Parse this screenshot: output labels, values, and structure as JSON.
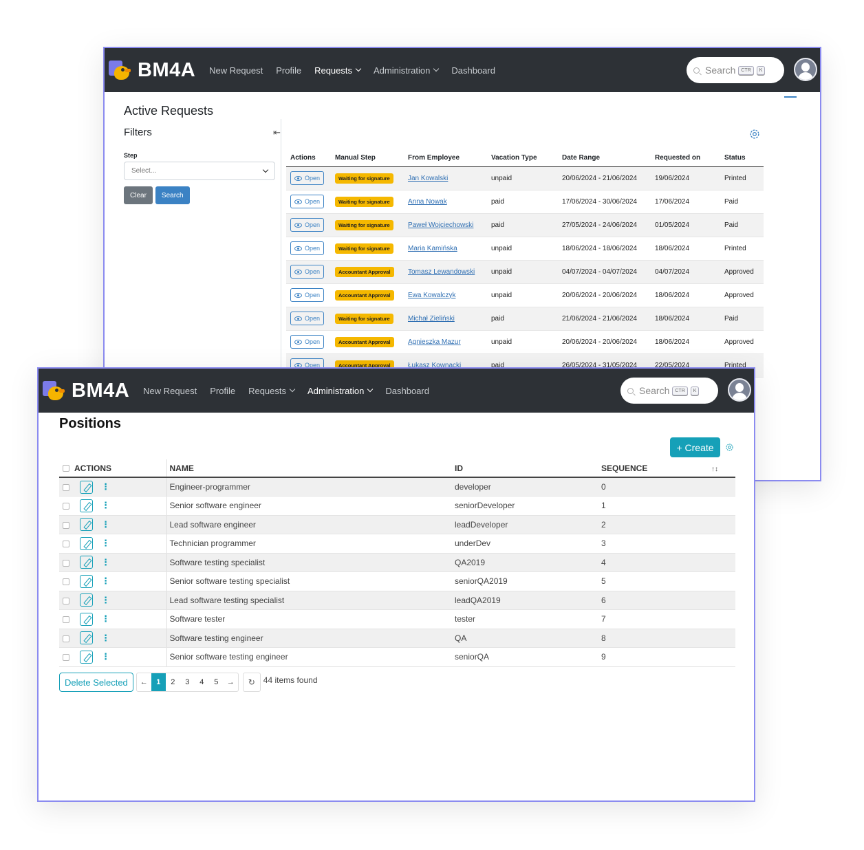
{
  "back_window": {
    "navbar": {
      "brand": "BM4A",
      "nav": [
        {
          "label": "New Request"
        },
        {
          "label": "Profile"
        },
        {
          "label": "Requests"
        },
        {
          "label": "Administration"
        },
        {
          "label": "Dashboard"
        }
      ],
      "search_placeholder": "Search",
      "shortcut_keys": [
        "CTR",
        "K"
      ]
    },
    "title": "Active Requests",
    "filters": {
      "title": "Filters",
      "step_label": "Step",
      "select_placeholder": "Select...",
      "clear_label": "Clear",
      "search_label": "Search"
    },
    "table": {
      "columns": [
        "Actions",
        "Manual Step",
        "From Employee",
        "Vacation Type",
        "Date Range",
        "Requested on",
        "Status"
      ],
      "open_label": "Open",
      "rows": [
        {
          "step": "Waiting for signature",
          "employee": "Jan Kowalski",
          "type": "unpaid",
          "range": "20/06/2024 - 21/06/2024",
          "requested": "19/06/2024",
          "status": "Printed"
        },
        {
          "step": "Waiting for signature",
          "employee": "Anna Nowak",
          "type": "paid",
          "range": "17/06/2024 - 30/06/2024",
          "requested": "17/06/2024",
          "status": "Paid"
        },
        {
          "step": "Waiting for signature",
          "employee": "Paweł Wojciechowski",
          "type": "paid",
          "range": "27/05/2024 - 24/06/2024",
          "requested": "01/05/2024",
          "status": "Paid"
        },
        {
          "step": "Waiting for signature",
          "employee": "Maria Kamińska",
          "type": "unpaid",
          "range": "18/06/2024 - 18/06/2024",
          "requested": "18/06/2024",
          "status": "Printed"
        },
        {
          "step": "Accountant Approval",
          "employee": "Tomasz Lewandowski",
          "type": "unpaid",
          "range": "04/07/2024 - 04/07/2024",
          "requested": "04/07/2024",
          "status": "Approved"
        },
        {
          "step": "Accountant Approval",
          "employee": "Ewa Kowalczyk",
          "type": "unpaid",
          "range": "20/06/2024 - 20/06/2024",
          "requested": "18/06/2024",
          "status": "Approved"
        },
        {
          "step": "Waiting for signature",
          "employee": "Michał Zieliński",
          "type": "paid",
          "range": "21/06/2024 - 21/06/2024",
          "requested": "18/06/2024",
          "status": "Paid"
        },
        {
          "step": "Accountant Approval",
          "employee": "Agnieszka Mazur",
          "type": "unpaid",
          "range": "20/06/2024 - 20/06/2024",
          "requested": "18/06/2024",
          "status": "Approved"
        },
        {
          "step": "Accountant Approval",
          "employee": "Łukasz Kownacki",
          "type": "paid",
          "range": "26/05/2024 - 31/05/2024",
          "requested": "22/05/2024",
          "status": "Printed"
        }
      ]
    }
  },
  "front_window": {
    "navbar": {
      "brand": "BM4A",
      "nav": [
        {
          "label": "New Request"
        },
        {
          "label": "Profile"
        },
        {
          "label": "Requests"
        },
        {
          "label": "Administration"
        },
        {
          "label": "Dashboard"
        }
      ],
      "search_placeholder": "Search",
      "shortcut_keys": [
        "CTR",
        "K"
      ]
    },
    "title": "Positions",
    "create_label": "+ Create",
    "table": {
      "columns": [
        "ACTIONS",
        "NAME",
        "ID",
        "SEQUENCE"
      ],
      "rows": [
        {
          "name": "Engineer-programmer",
          "id": "developer",
          "seq": "0"
        },
        {
          "name": "Senior software engineer",
          "id": "seniorDeveloper",
          "seq": "1"
        },
        {
          "name": "Lead software engineer",
          "id": "leadDeveloper",
          "seq": "2"
        },
        {
          "name": "Technician programmer",
          "id": "underDev",
          "seq": "3"
        },
        {
          "name": "Software testing specialist",
          "id": "QA2019",
          "seq": "4"
        },
        {
          "name": "Senior software testing specialist",
          "id": "seniorQA2019",
          "seq": "5"
        },
        {
          "name": "Lead software testing specialist",
          "id": "leadQA2019",
          "seq": "6"
        },
        {
          "name": "Software tester",
          "id": "tester",
          "seq": "7"
        },
        {
          "name": "Software testing engineer",
          "id": "QA",
          "seq": "8"
        },
        {
          "name": "Senior software testing engineer",
          "id": "seniorQA",
          "seq": "9"
        }
      ]
    },
    "footer": {
      "delete_label": "Delete Selected",
      "prev": "←",
      "pages": [
        "1",
        "2",
        "3",
        "4",
        "5"
      ],
      "current_page": "1",
      "next": "→",
      "refresh": "↻",
      "count_text": "44 items found"
    }
  },
  "colors": {
    "navbar_bg": "#2d3136",
    "accent_teal": "#16a0b8",
    "accent_blue": "#3b82c4",
    "badge_yellow": "#f5b800",
    "window_border": "#8b8bf0"
  }
}
